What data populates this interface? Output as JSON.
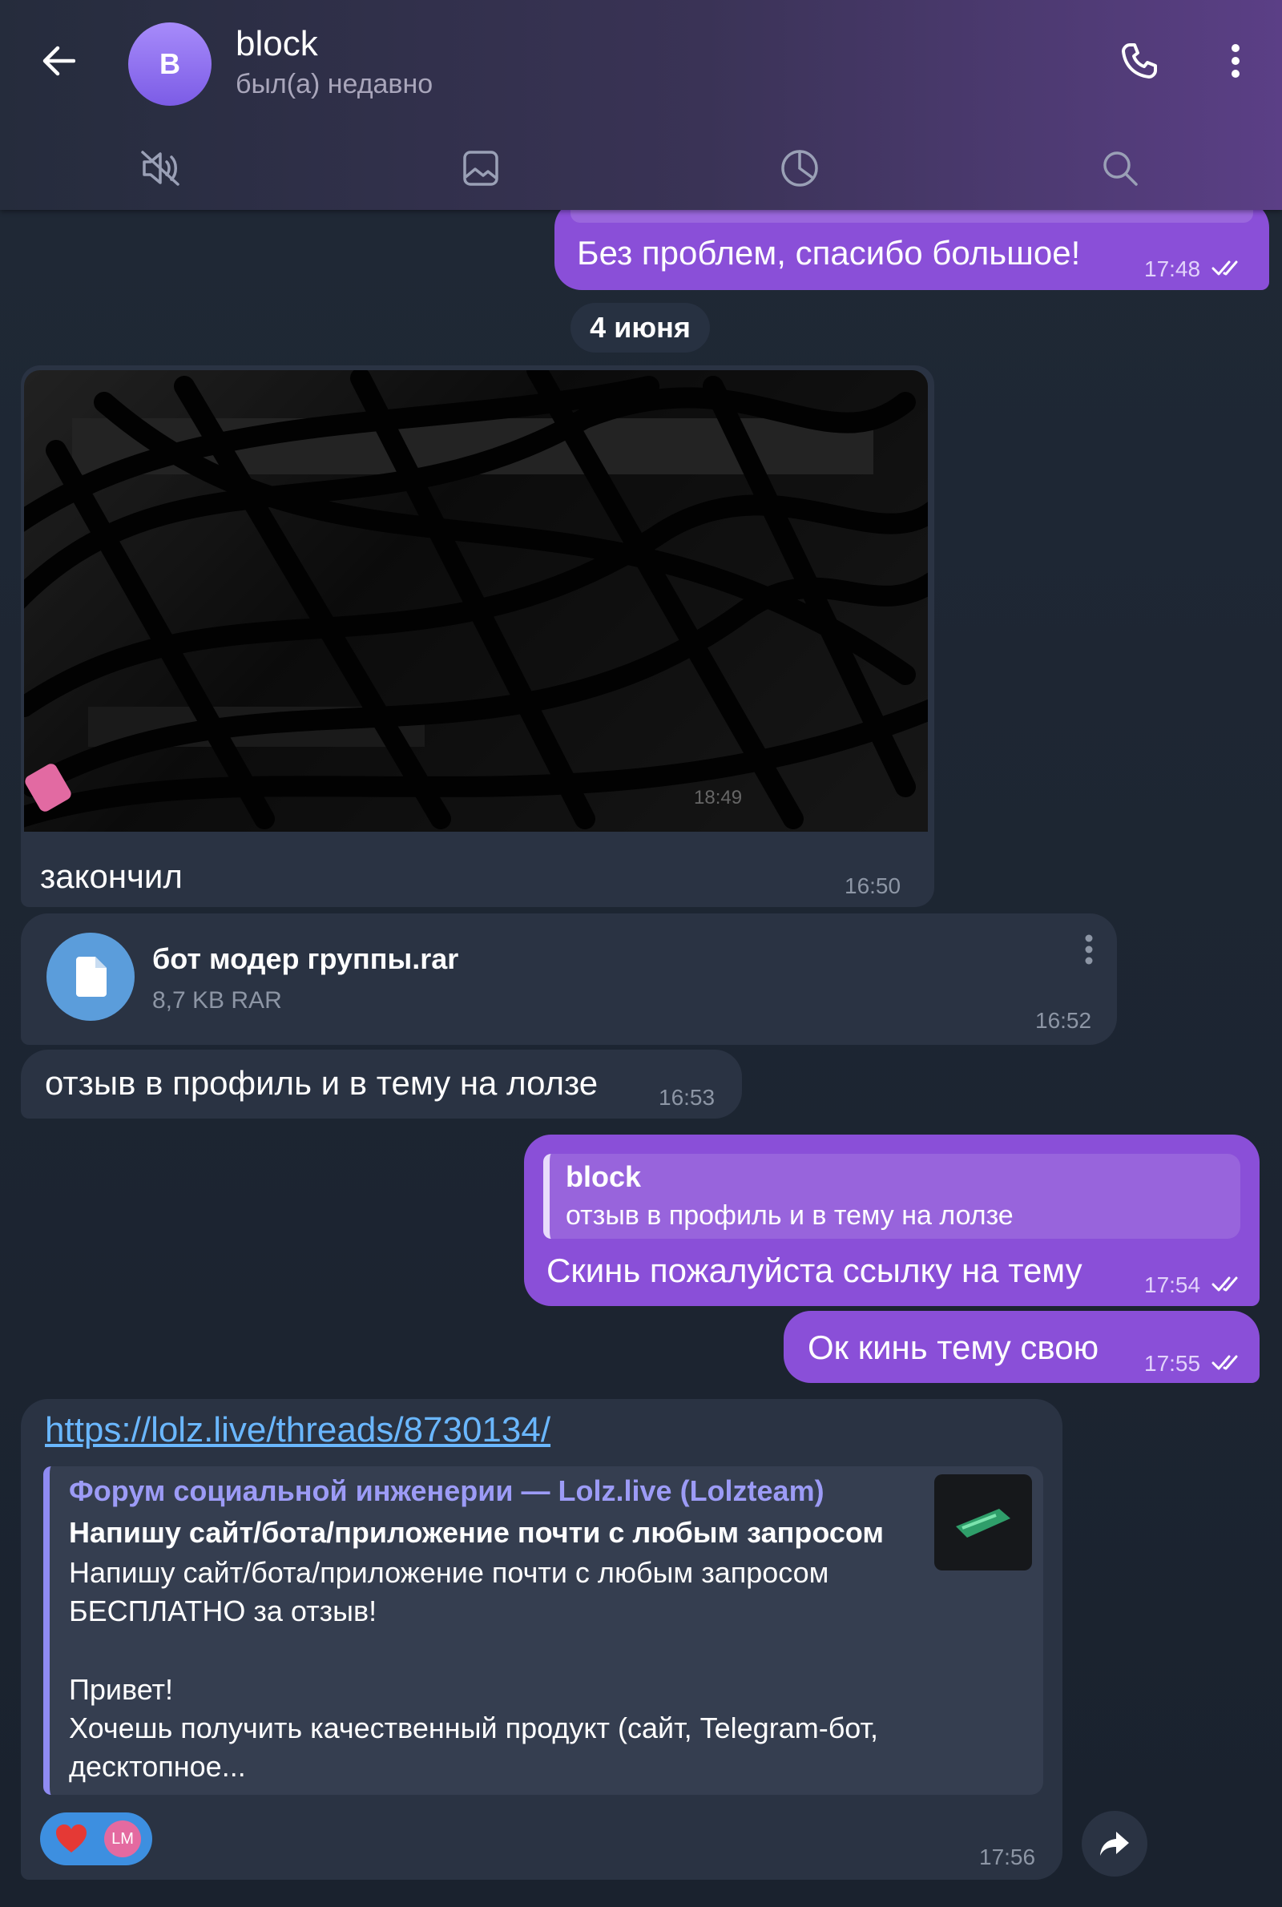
{
  "header": {
    "avatar_letter": "B",
    "title": "block",
    "status": "был(а) недавно",
    "colors": {
      "avatar": "#8b6cf0",
      "accent": "#8a4fd8"
    },
    "icons": [
      "back-arrow-icon",
      "phone-icon",
      "more-vert-icon"
    ],
    "tabs": [
      {
        "name": "mute",
        "icon": "muted-speaker-icon"
      },
      {
        "name": "media",
        "icon": "image-icon"
      },
      {
        "name": "timer",
        "icon": "clock-icon"
      },
      {
        "name": "search",
        "icon": "search-icon"
      }
    ]
  },
  "messages": {
    "m1": {
      "text": "Без проблем, спасибо большое!",
      "time": "17:48"
    },
    "date_separator": "4 июня",
    "photo": {
      "time_overlay": "18:49",
      "caption": "закончил",
      "time": "16:50"
    },
    "file": {
      "name": "бот модер группы.rar",
      "size": "8,7 KB RAR",
      "time": "16:52"
    },
    "m3": {
      "text": "отзыв в профиль и в тему на лолзе",
      "time": "16:53"
    },
    "m4": {
      "reply_author": "block",
      "reply_text": "отзыв в профиль и в тему на лолзе",
      "text": "Скинь пожалуйста ссылку на тему",
      "time": "17:54"
    },
    "m5": {
      "text": "Ок кинь тему свою",
      "time": "17:55"
    },
    "m6": {
      "link": "https://lolz.live/threads/8730134/",
      "preview_site": "Форум социальной инженерии —  Lolz.live (Lolzteam)",
      "preview_title": "Напишу сайт/бота/приложение почти с любым запросом",
      "preview_line1": "Напишу сайт/бота/приложение почти с любым запросом",
      "preview_line2": "БЕСПЛАТНО за отзыв!",
      "preview_line3": "Привет!",
      "preview_line4": "Хочешь получить качественный продукт (сайт, Telegram-бот,",
      "preview_line5": "десктопное...",
      "reaction_initials": "LM",
      "time": "17:56"
    }
  }
}
